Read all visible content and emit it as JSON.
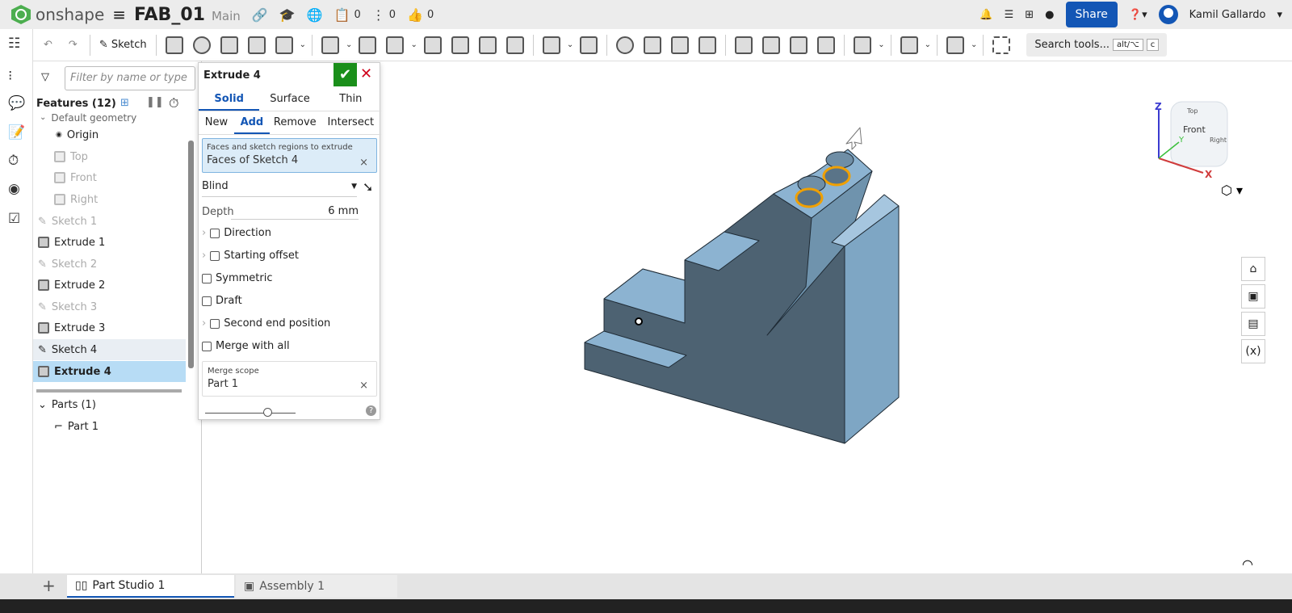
{
  "header": {
    "brand": "onshape",
    "document": "FAB_01",
    "branch": "Main",
    "counts": {
      "versions": "0",
      "branches": "0",
      "likes": "0"
    },
    "share": "Share",
    "user": "Kamil Gallardo"
  },
  "toolbar": {
    "sketch": "Sketch",
    "search": "Search tools...",
    "kbd1": "alt/⌥",
    "kbd2": "c"
  },
  "features": {
    "filter_placeholder": "Filter by name or type",
    "title": "Features (12)",
    "default_geometry": "Default geometry",
    "items": [
      {
        "label": "Origin"
      },
      {
        "label": "Top"
      },
      {
        "label": "Front"
      },
      {
        "label": "Right"
      },
      {
        "label": "Sketch 1"
      },
      {
        "label": "Extrude 1"
      },
      {
        "label": "Sketch 2"
      },
      {
        "label": "Extrude 2"
      },
      {
        "label": "Sketch 3"
      },
      {
        "label": "Extrude 3"
      },
      {
        "label": "Sketch 4"
      },
      {
        "label": "Extrude 4"
      }
    ],
    "parts_title": "Parts (1)",
    "part": "Part 1"
  },
  "dialog": {
    "title": "Extrude 4",
    "tabs": [
      "Solid",
      "Surface",
      "Thin"
    ],
    "ops": [
      "New",
      "Add",
      "Remove",
      "Intersect"
    ],
    "selection_label": "Faces and sketch regions to extrude",
    "selection_value": "Faces of Sketch 4",
    "end_type": "Blind",
    "depth_label": "Depth",
    "depth_value": "6 mm",
    "options": [
      "Direction",
      "Starting offset",
      "Symmetric",
      "Draft",
      "Second end position",
      "Merge with all"
    ],
    "merge_scope_label": "Merge scope",
    "merge_scope_value": "Part 1"
  },
  "viewcube": {
    "top": "Top",
    "front": "Front",
    "right": "Right",
    "x": "X",
    "y": "Y",
    "z": "Z"
  },
  "tabs": [
    "Part Studio 1",
    "Assembly 1"
  ]
}
